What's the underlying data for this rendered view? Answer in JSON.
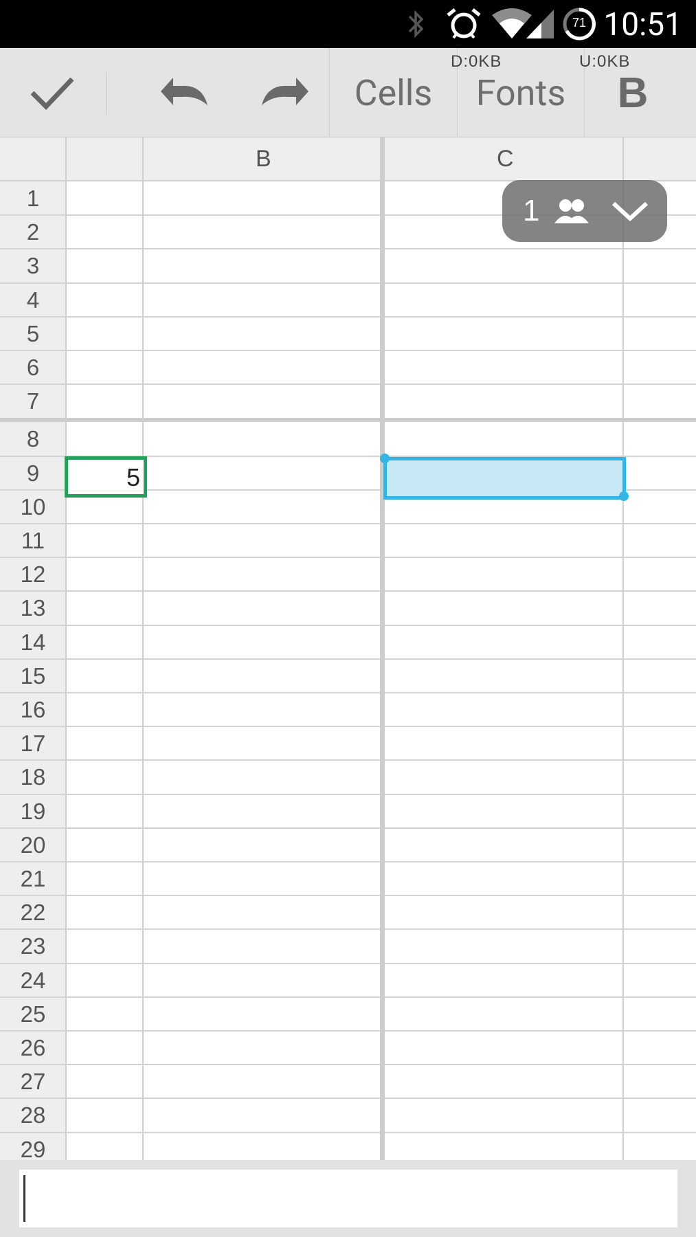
{
  "status_bar": {
    "time": "10:51",
    "battery_level": "71",
    "icons": [
      "bluetooth-icon",
      "alarm-icon",
      "wifi-icon",
      "signal-icon",
      "battery-icon"
    ]
  },
  "toolbar": {
    "confirm_icon": "check-icon",
    "undo_icon": "undo-icon",
    "redo_icon": "redo-icon",
    "cells_label": "Cells",
    "fonts_label": "Fonts",
    "bold_label": "B",
    "download_speed": "D:0KB",
    "upload_speed": "U:0KB"
  },
  "sheet": {
    "columns": [
      "",
      "B",
      "C"
    ],
    "rows": [
      "1",
      "2",
      "3",
      "4",
      "5",
      "6",
      "7",
      "8",
      "9",
      "10",
      "11",
      "12",
      "13",
      "14",
      "15",
      "16",
      "17",
      "18",
      "19",
      "20",
      "21",
      "22",
      "23",
      "24",
      "25",
      "26",
      "27",
      "28",
      "29"
    ],
    "active_cell_value": "5",
    "collaborators": {
      "count": "1",
      "icon": "people-icon",
      "toggle_icon": "chevron-down-icon"
    }
  },
  "formula_bar": {
    "value": "",
    "placeholder": ""
  },
  "colors": {
    "active_cell_border": "#23a15a",
    "selection_border": "#33b5e5",
    "selection_fill": "#c6e9f5"
  }
}
